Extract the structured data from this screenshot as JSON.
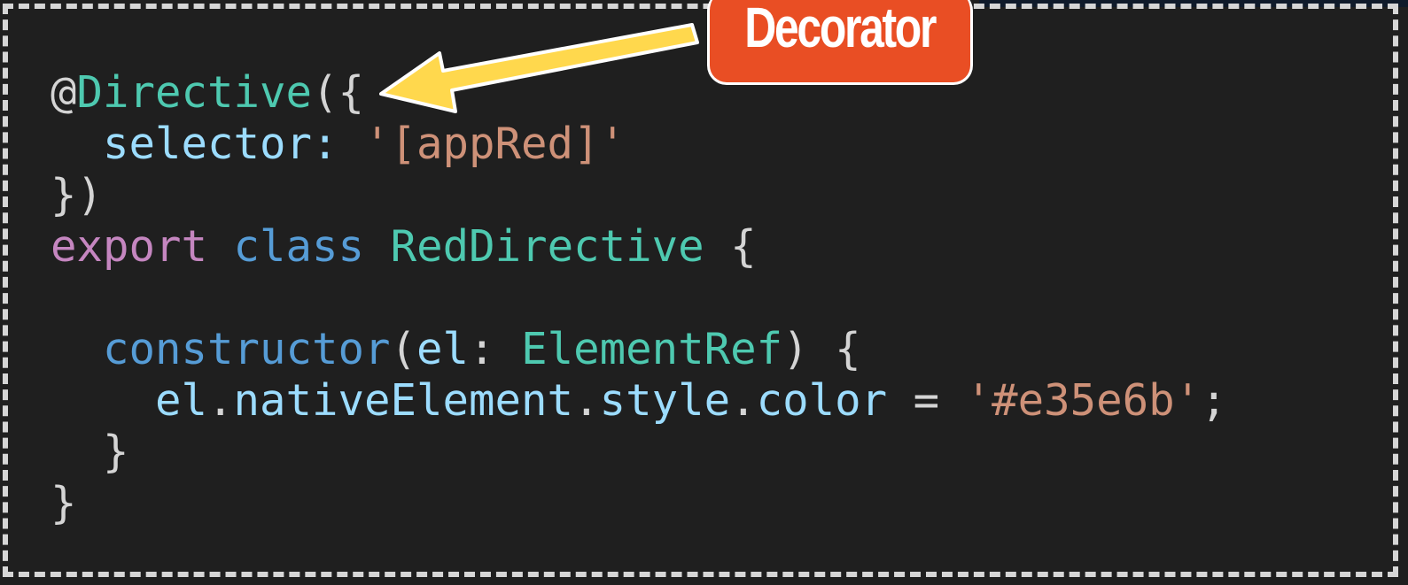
{
  "callout": {
    "label": "Decorator",
    "color": "#e94e24",
    "arrow_color": "#ffd84d"
  },
  "code": {
    "lines": [
      [
        {
          "t": "@",
          "c": "punc"
        },
        {
          "t": "Directive",
          "c": "type"
        },
        {
          "t": "({",
          "c": "punc"
        }
      ],
      [
        {
          "t": "  ",
          "c": "punc"
        },
        {
          "t": "selector",
          "c": "ident"
        },
        {
          "t": ": ",
          "c": "ident"
        },
        {
          "t": "'[appRed]'",
          "c": "str"
        }
      ],
      [
        {
          "t": "})",
          "c": "punc"
        }
      ],
      [
        {
          "t": "export",
          "c": "kw"
        },
        {
          "t": " ",
          "c": "punc"
        },
        {
          "t": "class",
          "c": "kw2"
        },
        {
          "t": " ",
          "c": "punc"
        },
        {
          "t": "RedDirective",
          "c": "type"
        },
        {
          "t": " {",
          "c": "punc"
        }
      ],
      [],
      [
        {
          "t": "  ",
          "c": "punc"
        },
        {
          "t": "constructor",
          "c": "kw2"
        },
        {
          "t": "(",
          "c": "punc"
        },
        {
          "t": "el",
          "c": "ident"
        },
        {
          "t": ": ",
          "c": "punc"
        },
        {
          "t": "ElementRef",
          "c": "type"
        },
        {
          "t": ") {",
          "c": "punc"
        }
      ],
      [
        {
          "t": "    ",
          "c": "punc"
        },
        {
          "t": "el",
          "c": "ident"
        },
        {
          "t": ".",
          "c": "punc"
        },
        {
          "t": "nativeElement",
          "c": "ident"
        },
        {
          "t": ".",
          "c": "punc"
        },
        {
          "t": "style",
          "c": "ident"
        },
        {
          "t": ".",
          "c": "punc"
        },
        {
          "t": "color",
          "c": "ident"
        },
        {
          "t": " = ",
          "c": "punc"
        },
        {
          "t": "'#e35e6b'",
          "c": "str"
        },
        {
          "t": ";",
          "c": "punc"
        }
      ],
      [
        {
          "t": "  ",
          "c": "punc"
        },
        {
          "t": "}",
          "c": "punc"
        }
      ],
      [
        {
          "t": "}",
          "c": "punc"
        }
      ]
    ]
  }
}
